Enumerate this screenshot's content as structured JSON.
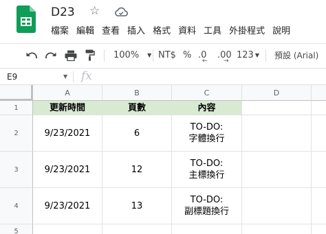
{
  "app": {
    "document_title": "D23",
    "icons": {
      "logo": "sheets-logo-icon",
      "star": "star-icon",
      "cloud": "cloud-status-icon"
    },
    "brand_color": "#0f9d58"
  },
  "menu": {
    "items": [
      "檔案",
      "編輯",
      "查看",
      "插入",
      "格式",
      "資料",
      "工具",
      "外掛程式",
      "說明"
    ]
  },
  "toolbar": {
    "zoom": "100%",
    "currency": "NT$",
    "percent": "%",
    "decrease_decimal": ".0",
    "increase_decimal": ".00",
    "more_formats": "123",
    "font": "預設 (Arial)"
  },
  "formula_bar": {
    "cell_ref": "E9",
    "fx": "fx"
  },
  "grid": {
    "columns": [
      "A",
      "B",
      "C",
      "D"
    ],
    "rows": [
      "1",
      "2",
      "3",
      "4",
      "5"
    ],
    "header_fill": "#d9ead3",
    "cells": [
      [
        "更新時間",
        "頁數",
        "內容",
        ""
      ],
      [
        "9/23/2021",
        "6",
        "TO-DO:\n字體換行",
        ""
      ],
      [
        "9/23/2021",
        "12",
        "TO-DO:\n主標換行",
        ""
      ],
      [
        "9/23/2021",
        "13",
        "TO-DO:\n副標題換行",
        ""
      ],
      [
        "",
        "",
        "",
        ""
      ]
    ]
  }
}
